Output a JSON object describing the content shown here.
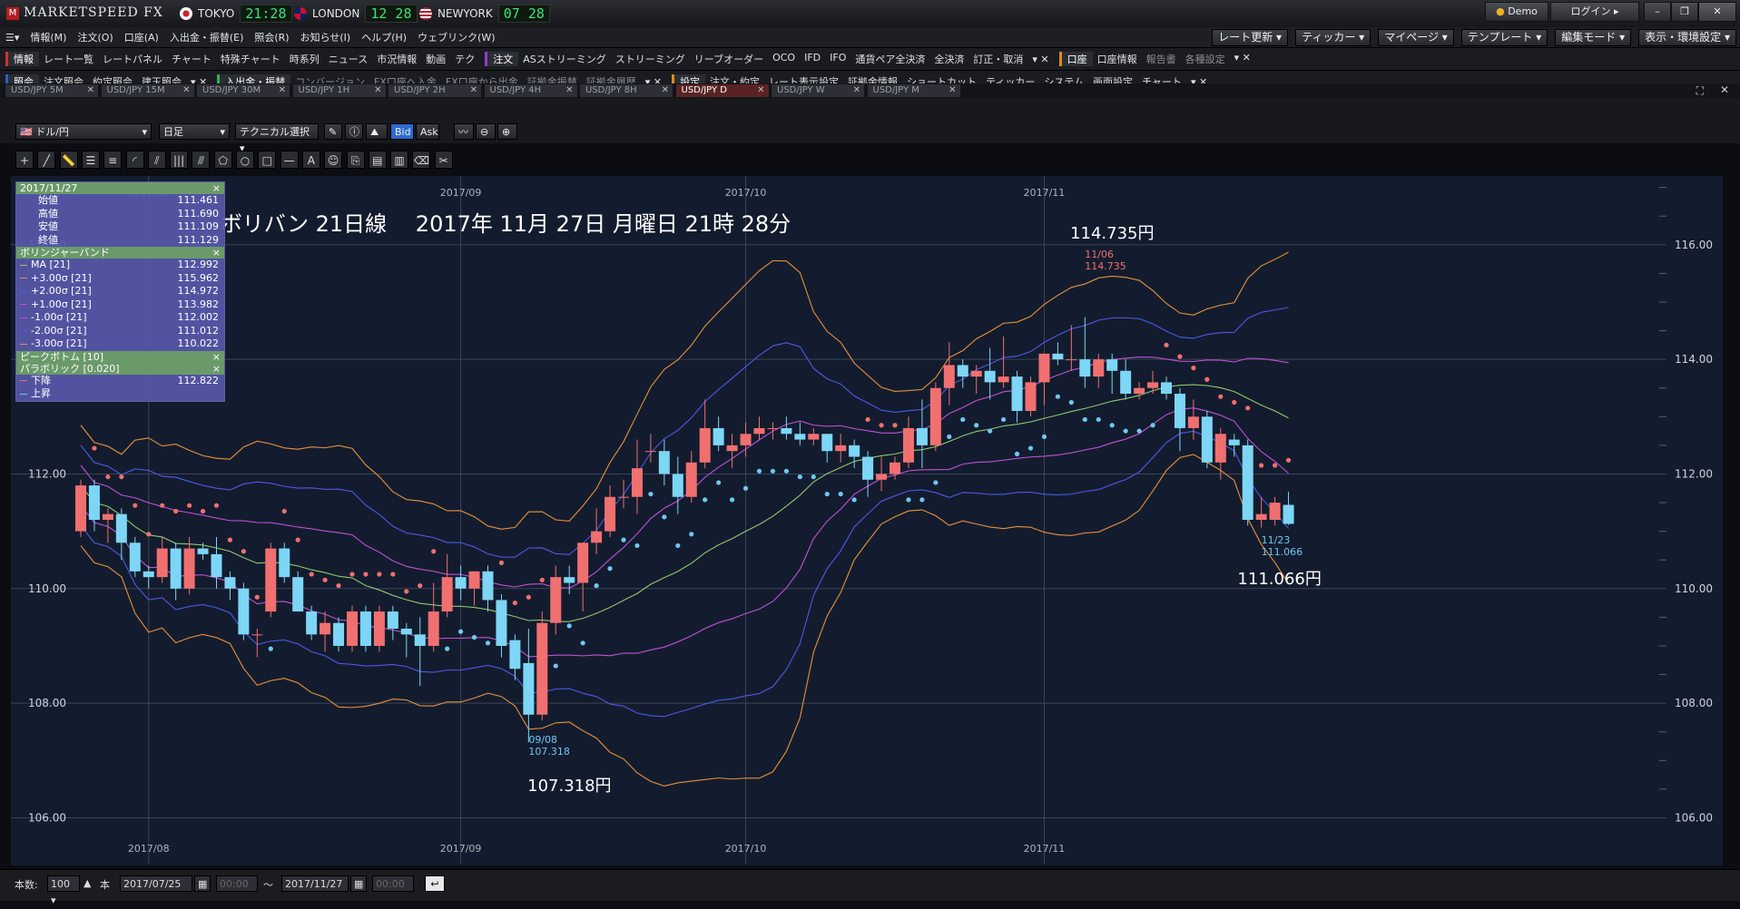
{
  "app": {
    "title": "MARKETSPEED FX",
    "logo_text": "M"
  },
  "clocks": [
    {
      "city": "TOKYO",
      "time": "21:28"
    },
    {
      "city": "LONDON",
      "time": "12 28"
    },
    {
      "city": "NEWYORK",
      "time": "07 28"
    }
  ],
  "window_buttons": {
    "demo": "Demo",
    "login": "ログイン"
  },
  "menu": [
    "情報(M)",
    "注文(O)",
    "口座(A)",
    "入出金・振替(E)",
    "照会(R)",
    "お知らせ(I)",
    "ヘルプ(H)",
    "ウェブリンク(W)"
  ],
  "menu_right": [
    "レート更新",
    "ティッカー",
    "マイページ",
    "テンプレート",
    "編集モード",
    "表示・環境設定"
  ],
  "toolbar1": {
    "group1_head": "情報",
    "group1": [
      "レート一覧",
      "レートパネル",
      "チャート",
      "特殊チャート",
      "時系列",
      "ニュース",
      "市況情報",
      "動画",
      "テク"
    ],
    "group2_head": "注文",
    "group2": [
      "ASストリーミング",
      "ストリーミング",
      "リーブオーダー",
      "OCO",
      "IFD",
      "IFO",
      "通貨ペア全決済",
      "全決済",
      "訂正・取消"
    ],
    "group3_head": "口座",
    "group3": [
      "口座情報"
    ],
    "group3_dim": [
      "報告書",
      "各種設定"
    ]
  },
  "toolbar2": {
    "group1_head": "照会",
    "group1": [
      "注文照会",
      "約定照会",
      "建玉照会"
    ],
    "group2_head": "入出金・振替",
    "group2_dim": [
      "コンバージョン",
      "FX口座へ入金",
      "FX口座から出金",
      "証拠金振替",
      "証拠金履歴"
    ],
    "group3_head": "設定",
    "group3": [
      "注文・約定",
      "レート表示設定",
      "証拠金情報",
      "ショートカット",
      "ティッカー",
      "システム",
      "画面設定",
      "チャート"
    ]
  },
  "tabs": [
    "USD/JPY 5M",
    "USD/JPY 15M",
    "USD/JPY 30M",
    "USD/JPY 1H",
    "USD/JPY 2H",
    "USD/JPY 4H",
    "USD/JPY 8H",
    "USD/JPY D",
    "USD/JPY W",
    "USD/JPY M"
  ],
  "active_tab": "USD/JPY D",
  "chart_controls": {
    "pair": "ドル/円",
    "period": "日足",
    "technical": "テクニカル選択",
    "bid": "Bid",
    "ask": "Ask"
  },
  "info_panel": {
    "date": "2017/11/27",
    "ohlc": [
      {
        "label": "始値",
        "value": "111.461"
      },
      {
        "label": "高値",
        "value": "111.690"
      },
      {
        "label": "安値",
        "value": "111.109"
      },
      {
        "label": "終値",
        "value": "111.129"
      }
    ],
    "bb_title": "ボリンジャーバンド",
    "bb": [
      {
        "label": "MA [21]",
        "value": "112.992",
        "color": "#8ec86e"
      },
      {
        "label": "+3.00σ [21]",
        "value": "115.962",
        "color": "#e8903a"
      },
      {
        "label": "+2.00σ [21]",
        "value": "114.972",
        "color": "#4a5ae8"
      },
      {
        "label": "+1.00σ [21]",
        "value": "113.982",
        "color": "#c050d8"
      },
      {
        "label": "-1.00σ [21]",
        "value": "112.002",
        "color": "#c050d8"
      },
      {
        "label": "-2.00σ [21]",
        "value": "111.012",
        "color": "#4a5ae8"
      },
      {
        "label": "-3.00σ [21]",
        "value": "110.022",
        "color": "#e8903a"
      }
    ],
    "pb_title": "ピークボトム [10]",
    "sar_title": "パラボリック [0.020]",
    "sar": [
      {
        "label": "下降",
        "value": "112.822",
        "color": "#f07070"
      },
      {
        "label": "上昇",
        "value": "",
        "color": "#70c8f0"
      }
    ]
  },
  "status": {
    "count_label": "本数:",
    "count": "100",
    "unit": "本",
    "from": "2017/07/25",
    "from_time": "00:00",
    "sep": "〜",
    "to": "2017/11/27",
    "to_time": "00:00"
  },
  "chart_data": {
    "type": "candlestick",
    "title": "ボリバン 21日線　 2017年 11月 27日 月曜日 21時 28分",
    "ylim": [
      105.2,
      117.2
    ],
    "yticks": [
      "106.00",
      "108.00",
      "110.00",
      "112.00",
      "114.00",
      "116.00"
    ],
    "months": [
      {
        "label": "2017/08",
        "date": "2017-08-01"
      },
      {
        "label": "2017/09",
        "date": "2017-09-01"
      },
      {
        "label": "2017/10",
        "date": "2017-10-02"
      },
      {
        "label": "2017/11",
        "date": "2017-11-01"
      }
    ],
    "annotations": {
      "high_price": "114.735円",
      "high_date": "11/06",
      "high_value": "114.735",
      "low_price": "107.318円",
      "low_date": "09/08",
      "low_value": "107.318",
      "last_low_price": "111.066円",
      "last_low_date": "11/23",
      "last_low_value": "111.066"
    },
    "candles": [
      [
        "07/25",
        111.0,
        111.9,
        110.9,
        111.8
      ],
      [
        "07/26",
        111.8,
        111.9,
        111.0,
        111.2
      ],
      [
        "07/27",
        111.2,
        111.4,
        110.8,
        111.3
      ],
      [
        "07/28",
        111.3,
        111.4,
        110.5,
        110.8
      ],
      [
        "07/31",
        110.8,
        110.9,
        110.2,
        110.3
      ],
      [
        "08/01",
        110.3,
        110.4,
        110.0,
        110.2
      ],
      [
        "08/02",
        110.2,
        110.9,
        110.1,
        110.7
      ],
      [
        "08/03",
        110.7,
        110.8,
        109.8,
        110.0
      ],
      [
        "08/04",
        110.0,
        110.9,
        109.9,
        110.7
      ],
      [
        "08/07",
        110.7,
        110.8,
        110.5,
        110.6
      ],
      [
        "08/08",
        110.6,
        110.9,
        110.0,
        110.2
      ],
      [
        "08/09",
        110.2,
        110.3,
        109.8,
        110.0
      ],
      [
        "08/10",
        110.0,
        110.1,
        109.1,
        109.2
      ],
      [
        "08/11",
        109.2,
        109.3,
        108.8,
        109.2
      ],
      [
        "08/14",
        109.6,
        110.8,
        109.5,
        110.7
      ],
      [
        "08/15",
        110.7,
        110.8,
        110.1,
        110.2
      ],
      [
        "08/16",
        110.2,
        110.3,
        109.6,
        109.6
      ],
      [
        "08/17",
        109.6,
        109.7,
        109.1,
        109.2
      ],
      [
        "08/18",
        109.2,
        109.6,
        108.9,
        109.4
      ],
      [
        "08/21",
        109.4,
        109.5,
        108.9,
        109.0
      ],
      [
        "08/22",
        109.0,
        109.7,
        108.9,
        109.6
      ],
      [
        "08/23",
        109.6,
        109.7,
        108.9,
        109.0
      ],
      [
        "08/24",
        109.0,
        109.7,
        108.9,
        109.6
      ],
      [
        "08/25",
        109.6,
        109.7,
        109.1,
        109.3
      ],
      [
        "08/28",
        109.3,
        109.4,
        108.8,
        109.2
      ],
      [
        "08/29",
        109.2,
        109.5,
        108.3,
        109.0
      ],
      [
        "08/30",
        109.0,
        110.1,
        108.9,
        109.6
      ],
      [
        "08/31",
        109.6,
        110.6,
        109.5,
        110.2
      ],
      [
        "09/01",
        110.2,
        110.4,
        109.8,
        110.0
      ],
      [
        "09/04",
        110.0,
        110.3,
        109.7,
        110.3
      ],
      [
        "09/05",
        110.3,
        110.4,
        109.6,
        109.8
      ],
      [
        "09/06",
        109.8,
        109.9,
        108.8,
        109.0
      ],
      [
        "09/07",
        109.1,
        109.2,
        108.4,
        108.6
      ],
      [
        "09/08",
        108.7,
        109.3,
        107.318,
        107.8
      ],
      [
        "09/11",
        107.8,
        109.6,
        107.7,
        109.4
      ],
      [
        "09/12",
        109.4,
        110.4,
        109.2,
        110.2
      ],
      [
        "09/13",
        110.2,
        110.4,
        109.9,
        110.1
      ],
      [
        "09/14",
        110.1,
        110.8,
        109.6,
        110.8
      ],
      [
        "09/15",
        110.8,
        111.4,
        110.6,
        111.0
      ],
      [
        "09/18",
        111.0,
        111.8,
        110.9,
        111.6
      ],
      [
        "09/19",
        111.6,
        111.9,
        111.4,
        111.6
      ],
      [
        "09/20",
        111.6,
        112.6,
        111.3,
        112.1
      ],
      [
        "09/21",
        112.4,
        112.7,
        112.2,
        112.4
      ],
      [
        "09/22",
        112.4,
        112.6,
        111.8,
        112.0
      ],
      [
        "09/25",
        112.0,
        112.3,
        111.3,
        111.6
      ],
      [
        "09/26",
        111.6,
        112.4,
        111.5,
        112.2
      ],
      [
        "09/27",
        112.2,
        113.3,
        112.1,
        112.8
      ],
      [
        "09/28",
        112.8,
        113.0,
        112.4,
        112.5
      ],
      [
        "09/29",
        112.4,
        112.7,
        112.1,
        112.5
      ],
      [
        "10/02",
        112.5,
        112.9,
        112.3,
        112.7
      ],
      [
        "10/03",
        112.7,
        113.0,
        112.6,
        112.8
      ],
      [
        "10/04",
        112.8,
        112.9,
        112.6,
        112.8
      ],
      [
        "10/05",
        112.8,
        113.0,
        112.6,
        112.7
      ],
      [
        "10/06",
        112.7,
        112.9,
        112.5,
        112.6
      ],
      [
        "10/09",
        112.6,
        112.8,
        112.5,
        112.7
      ],
      [
        "10/10",
        112.7,
        112.7,
        112.2,
        112.4
      ],
      [
        "10/11",
        112.4,
        112.7,
        112.2,
        112.5
      ],
      [
        "10/12",
        112.5,
        112.6,
        112.1,
        112.3
      ],
      [
        "10/13",
        112.3,
        112.4,
        111.6,
        111.9
      ],
      [
        "10/16",
        111.9,
        112.3,
        111.7,
        112.0
      ],
      [
        "10/17",
        112.0,
        112.3,
        111.9,
        112.2
      ],
      [
        "10/18",
        112.2,
        113.0,
        112.1,
        112.8
      ],
      [
        "10/19",
        112.8,
        113.3,
        112.1,
        112.5
      ],
      [
        "10/20",
        112.5,
        113.6,
        112.4,
        113.5
      ],
      [
        "10/23",
        113.5,
        114.3,
        113.2,
        113.9
      ],
      [
        "10/24",
        113.9,
        114.0,
        113.5,
        113.7
      ],
      [
        "10/25",
        113.7,
        113.9,
        113.4,
        113.8
      ],
      [
        "10/26",
        113.8,
        114.2,
        113.3,
        113.6
      ],
      [
        "10/27",
        113.6,
        114.4,
        113.5,
        113.7
      ],
      [
        "10/30",
        113.7,
        113.8,
        112.9,
        113.1
      ],
      [
        "10/31",
        113.1,
        113.7,
        113.0,
        113.6
      ],
      [
        "11/01",
        113.6,
        114.1,
        113.2,
        114.1
      ],
      [
        "11/02",
        114.1,
        114.3,
        113.9,
        114.0
      ],
      [
        "11/03",
        114.0,
        114.6,
        113.8,
        114.0
      ],
      [
        "11/06",
        114.0,
        114.735,
        113.5,
        113.7
      ],
      [
        "11/07",
        113.7,
        114.1,
        113.5,
        114.0
      ],
      [
        "11/08",
        114.0,
        114.1,
        113.4,
        113.8
      ],
      [
        "11/09",
        113.8,
        114.0,
        113.3,
        113.4
      ],
      [
        "11/10",
        113.4,
        113.6,
        113.3,
        113.5
      ],
      [
        "11/13",
        113.5,
        113.8,
        113.4,
        113.6
      ],
      [
        "11/14",
        113.6,
        113.7,
        113.3,
        113.4
      ],
      [
        "11/15",
        113.4,
        113.5,
        112.4,
        112.8
      ],
      [
        "11/16",
        112.8,
        113.3,
        112.6,
        113.0
      ],
      [
        "11/17",
        113.0,
        113.1,
        112.1,
        112.2
      ],
      [
        "11/20",
        112.2,
        112.8,
        111.9,
        112.7
      ],
      [
        "11/21",
        112.6,
        112.7,
        112.3,
        112.5
      ],
      [
        "11/22",
        112.5,
        112.6,
        111.1,
        111.2
      ],
      [
        "11/23",
        111.2,
        111.6,
        111.066,
        111.3
      ],
      [
        "11/24",
        111.2,
        111.6,
        111.1,
        111.5
      ],
      [
        "11/27",
        111.461,
        111.69,
        111.109,
        111.129
      ]
    ],
    "colors": {
      "up": "#f07070",
      "down": "#7dd6f5",
      "background": "#131c2e",
      "grid": "#3a4456"
    }
  }
}
